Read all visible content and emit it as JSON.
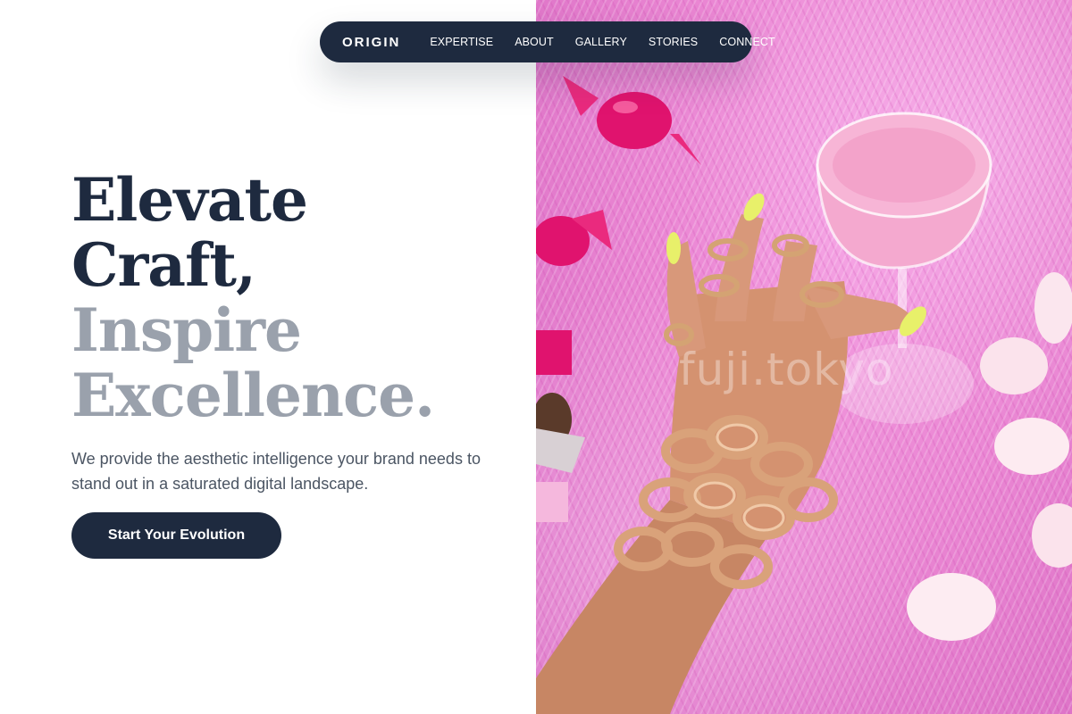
{
  "nav": {
    "logo": "ORIGIN",
    "links": [
      "EXPERTISE",
      "ABOUT",
      "GALLERY",
      "STORIES",
      "CONNECT"
    ]
  },
  "hero": {
    "title_line1": "Elevate",
    "title_line2": "Craft,",
    "title_line3": "Inspire",
    "title_line4": "Excellence.",
    "subtitle": "We provide the aesthetic intelligence your brand needs to stand out in a saturated digital landscape.",
    "cta_label": "Start Your Evolution"
  },
  "image": {
    "watermark": "fuji.tokyo",
    "description_icons": [
      "pink-fur-background",
      "cocktail-glass",
      "gold-chain-bracelets",
      "candy-wrappers",
      "rose-petals"
    ]
  },
  "colors": {
    "navy": "#1e2a3f",
    "muted_gray": "#9aa1ac",
    "body_text": "#4b5563",
    "pink_background": "#ea86d3",
    "nail_yellow": "#e8f06a",
    "gold": "#d4a373"
  }
}
